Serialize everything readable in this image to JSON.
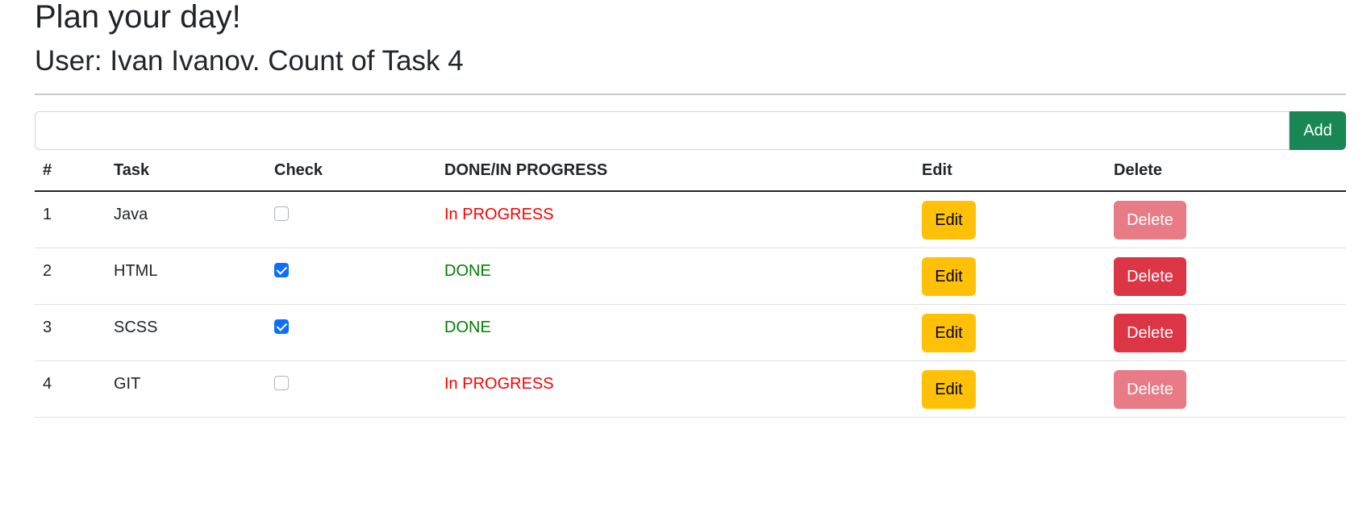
{
  "header": {
    "title": "Plan your day!",
    "subtitle": "User: Ivan Ivanov. Count of Task 4"
  },
  "form": {
    "input_value": "",
    "add_label": "Add",
    "add_color": "#198754"
  },
  "table": {
    "headers": [
      "#",
      "Task",
      "Check",
      "DONE/IN PROGRESS",
      "Edit",
      "Delete"
    ],
    "rows": [
      {
        "num": "1",
        "task": "Java",
        "checked": false,
        "status": "In PROGRESS",
        "edit": "Edit",
        "delete": "Delete",
        "delete_enabled": false
      },
      {
        "num": "2",
        "task": "HTML",
        "checked": true,
        "status": "DONE",
        "edit": "Edit",
        "delete": "Delete",
        "delete_enabled": true
      },
      {
        "num": "3",
        "task": "SCSS",
        "checked": true,
        "status": "DONE",
        "edit": "Edit",
        "delete": "Delete",
        "delete_enabled": true
      },
      {
        "num": "4",
        "task": "GIT",
        "checked": false,
        "status": "In PROGRESS",
        "edit": "Edit",
        "delete": "Delete",
        "delete_enabled": false
      }
    ]
  },
  "colors": {
    "in_progress": "#ff0000",
    "done": "#008000",
    "edit": "#ffc107",
    "delete": "#dc3545",
    "checkbox_checked": "#0d6efd"
  }
}
